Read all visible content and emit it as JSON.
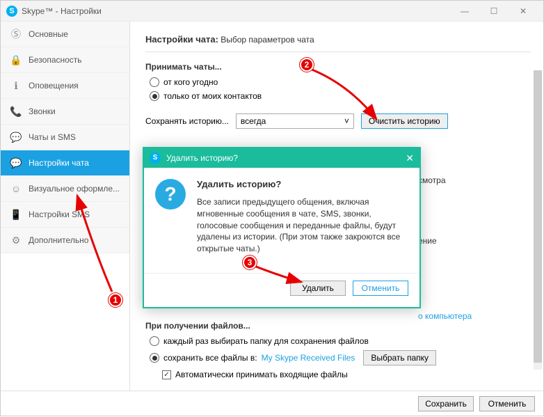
{
  "window": {
    "title": "Skype™ - Настройки"
  },
  "sidebar": {
    "items": [
      {
        "label": "Основные"
      },
      {
        "label": "Безопасность"
      },
      {
        "label": "Оповещения"
      },
      {
        "label": "Звонки"
      },
      {
        "label": "Чаты и SMS"
      },
      {
        "label": "Настройки чата"
      },
      {
        "label": "Визуальное оформле..."
      },
      {
        "label": "Настройки SMS"
      },
      {
        "label": "Дополнительно"
      }
    ]
  },
  "content": {
    "heading_bold": "Настройки чата:",
    "heading_rest": " Выбор параметров чата",
    "accept_title": "Принимать чаты...",
    "accept_anyone": "от кого угодно",
    "accept_contacts": "только от моих контактов",
    "history_label": "Сохранять историю...",
    "history_value": "всегда",
    "clear_btn": "Очистить историю",
    "peek_view": "смотра",
    "peek_change": "ение",
    "peek_computer": "о компьютера",
    "files_title": "При получении файлов...",
    "files_ask": "каждый раз выбирать папку для сохранения файлов",
    "files_save": "сохранить все файлы в:",
    "files_folder": "My Skype Received Files",
    "files_choose": "Выбрать папку",
    "auto_accept": "Автоматически принимать входящие файлы"
  },
  "dialog": {
    "title": "Удалить историю?",
    "heading": "Удалить историю?",
    "body": "Все записи предыдущего общения, включая мгновенные сообщения в чате, SMS, звонки, голосовые сообщения и переданные файлы, будут удалены из истории. (При этом также закроются все открытые чаты.)",
    "delete": "Удалить",
    "cancel": "Отменить"
  },
  "footer": {
    "save": "Сохранить",
    "cancel": "Отменить"
  },
  "badges": {
    "b1": "1",
    "b2": "2",
    "b3": "3"
  }
}
